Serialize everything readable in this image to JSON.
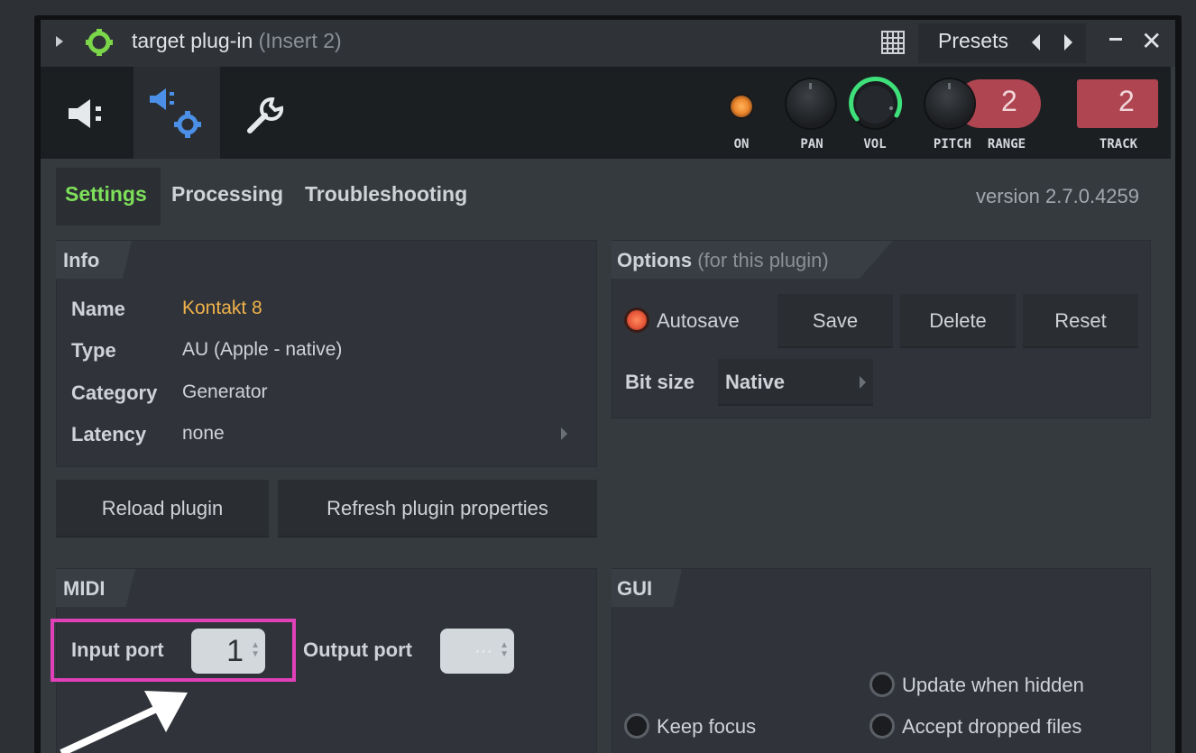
{
  "window": {
    "title": "target plug-in",
    "insert": "(Insert 2)",
    "presets_label": "Presets"
  },
  "toolbar": {
    "tools": [
      "plugin-icon",
      "plugin-settings-icon",
      "wrench-icon"
    ],
    "on_label": "ON",
    "pan_label": "PAN",
    "vol_label": "VOL",
    "pitch_label": "PITCH",
    "range_label": "RANGE",
    "range_value": "2",
    "track_label": "TRACK",
    "track_value": "2",
    "accent": "#b04552"
  },
  "tabs": {
    "settings": "Settings",
    "processing": "Processing",
    "troubleshooting": "Troubleshooting",
    "active": "Settings",
    "version": "version 2.7.0.4259"
  },
  "info": {
    "heading": "Info",
    "rows": [
      {
        "key": "Name",
        "value": "Kontakt 8"
      },
      {
        "key": "Type",
        "value": "AU (Apple - native)"
      },
      {
        "key": "Category",
        "value": "Generator"
      },
      {
        "key": "Latency",
        "value": "none"
      }
    ],
    "reload_button": "Reload plugin",
    "refresh_button": "Refresh plugin properties"
  },
  "options": {
    "heading": "Options",
    "heading_sub": "(for this plugin)",
    "autosave_label": "Autosave",
    "save_button": "Save",
    "delete_button": "Delete",
    "reset_button": "Reset",
    "bitsize_label": "Bit size",
    "bitsize_value": "Native"
  },
  "midi": {
    "heading": "MIDI",
    "input_label": "Input port",
    "input_value": "1",
    "output_label": "Output port",
    "output_value": "···"
  },
  "gui": {
    "heading": "GUI",
    "update_hidden": "Update when hidden",
    "keep_focus": "Keep focus",
    "accept_dropped": "Accept dropped files"
  },
  "annotation": {
    "highlight_color": "#e040b8",
    "arrow_color": "#ffffff"
  }
}
